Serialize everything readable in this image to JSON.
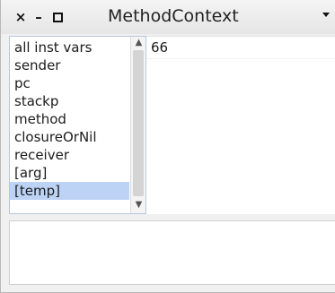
{
  "window": {
    "title": "MethodContext",
    "close_glyph": "×",
    "minimize_glyph": "–",
    "menu_icon": "triangle-down-icon"
  },
  "inspector": {
    "fields": [
      "all inst vars",
      "sender",
      "pc",
      "stackp",
      "method",
      "closureOrNil",
      "receiver",
      "[arg]",
      "[temp]"
    ],
    "selected_index": 8,
    "value": "66"
  },
  "colors": {
    "selection": "#bcd3f6",
    "list_border": "#b7c7dc"
  }
}
